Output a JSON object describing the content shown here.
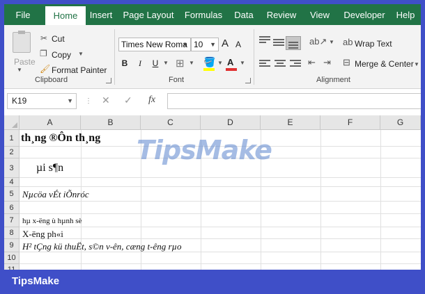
{
  "ribbon_tabs": [
    {
      "label": "File"
    },
    {
      "label": "Home"
    },
    {
      "label": "Insert"
    },
    {
      "label": "Page Layout"
    },
    {
      "label": "Formulas"
    },
    {
      "label": "Data"
    },
    {
      "label": "Review"
    },
    {
      "label": "View"
    },
    {
      "label": "Developer"
    },
    {
      "label": "Help"
    }
  ],
  "clipboard": {
    "paste_label": "Paste",
    "cut_label": "Cut",
    "copy_label": "Copy",
    "format_painter_label": "Format Painter",
    "group_label": "Clipboard"
  },
  "font": {
    "font_name": "Times New Roma",
    "font_size": "10",
    "grow_label": "A",
    "shrink_label": "A",
    "bold_label": "B",
    "italic_label": "I",
    "underline_label": "U",
    "fill_color": "#ffff00",
    "font_color": "#e03030",
    "group_label": "Font"
  },
  "alignment": {
    "wrap_text_label": "Wrap Text",
    "merge_center_label": "Merge & Center",
    "group_label": "Alignment"
  },
  "formula_bar": {
    "name_box": "K19",
    "fx_label": "fx",
    "formula_value": ""
  },
  "grid": {
    "columns": [
      "A",
      "B",
      "C",
      "D",
      "E",
      "F",
      "G"
    ],
    "rows": [
      {
        "num": "1",
        "text": "th¸ng  ®Ôn th¸ng",
        "style": "bold-large"
      },
      {
        "num": "2",
        "text": ""
      },
      {
        "num": "3",
        "text": "µi s¶n",
        "style": "large"
      },
      {
        "num": "4",
        "text": ""
      },
      {
        "num": "5",
        "text": "Nµcöa  vÉt iÕnróc",
        "style": "italic"
      },
      {
        "num": "6",
        "text": ""
      },
      {
        "num": "7",
        "text": "hµ x-ëng ù hµnh sè",
        "style": "small"
      },
      {
        "num": "8",
        "text": "X-ëng ph«i",
        "style": "normal"
      },
      {
        "num": "9",
        "text": "H² tÇng kü thuËt, s©n v-ên, cæng t-êng rµo",
        "style": "italic"
      },
      {
        "num": "10",
        "text": ""
      },
      {
        "num": "11",
        "text": ""
      }
    ]
  },
  "watermark": "TipsMake",
  "brand": "TipsMake"
}
